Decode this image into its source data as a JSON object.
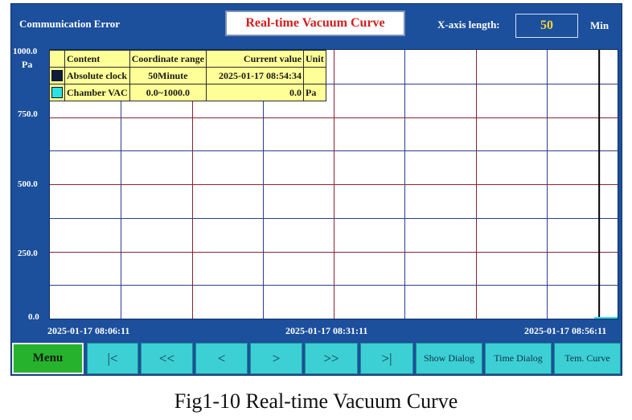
{
  "header": {
    "status": "Communication Error",
    "title": "Real-time Vacuum Curve",
    "x_axis_label": "X-axis length:",
    "x_axis_value": "50",
    "x_axis_unit": "Min"
  },
  "y_axis": {
    "unit": "Pa",
    "ticks": [
      "1000.0",
      "750.0",
      "500.0",
      "250.0",
      "0.0"
    ]
  },
  "x_axis": {
    "ticks": [
      "2025-01-17 08:06:11",
      "2025-01-17 08:31:11",
      "2025-01-17 08:56:11"
    ]
  },
  "legend": {
    "headers": [
      "Content",
      "Coordinate range",
      "Current value",
      "Unit"
    ],
    "rows": [
      {
        "color": "#0d1b3f",
        "content": "Absolute clock",
        "range": "50Minute",
        "value": "2025-01-17 08:54:34",
        "unit": ""
      },
      {
        "color": "#2de0e6",
        "content": "Chamber VAC",
        "range": "0.0~1000.0",
        "value": "0.0",
        "unit": "Pa"
      }
    ]
  },
  "toolbar": {
    "menu": "Menu",
    "first": "|<",
    "fast_back": "<<",
    "back": "<",
    "forward": ">",
    "fast_forward": ">>",
    "last": ">|",
    "show_dialog": "Show Dialog",
    "time_dialog": "Time Dialog",
    "tem_curve": "Tem. Curve"
  },
  "caption": "Fig1-10 Real-time Vacuum Curve",
  "chart_data": {
    "type": "line",
    "x": [
      "2025-01-17 08:06:11",
      "2025-01-17 08:31:11",
      "2025-01-17 08:56:11"
    ],
    "ylim": [
      0,
      1000
    ],
    "ylabel": "Pa",
    "grid": true,
    "legend_position": "top-left",
    "series": [
      {
        "name": "Chamber VAC",
        "color": "#2de0e6",
        "values": [
          0.0
        ]
      }
    ],
    "cursor_time": "2025-01-17 08:54:34"
  }
}
